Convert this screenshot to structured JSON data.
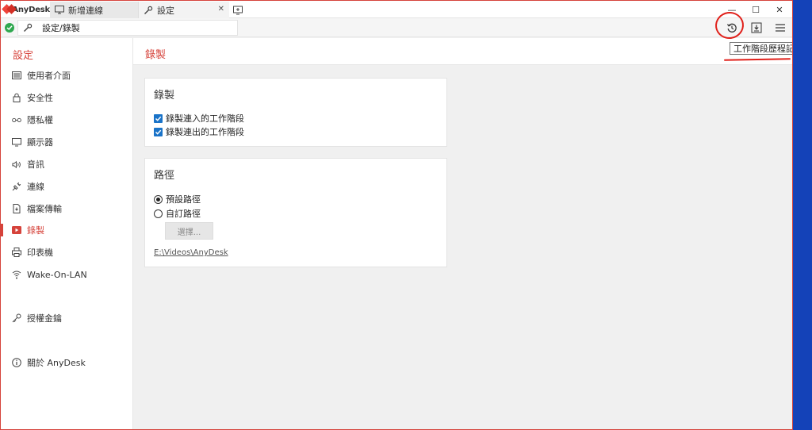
{
  "app": {
    "name": "AnyDesk"
  },
  "tabs": [
    {
      "label": "新增連線"
    },
    {
      "label": "設定"
    }
  ],
  "window_controls": {
    "minimize": "—",
    "maximize": "☐",
    "close": "✕"
  },
  "address": {
    "path": "設定/錄製"
  },
  "tooltip": {
    "text": "工作階段歷程記錄"
  },
  "sidebar": {
    "title": "設定",
    "items": [
      {
        "label": "使用者介面",
        "icon": "monitor-list-icon"
      },
      {
        "label": "安全性",
        "icon": "lock-icon"
      },
      {
        "label": "隱私權",
        "icon": "glasses-icon"
      },
      {
        "label": "顯示器",
        "icon": "display-icon"
      },
      {
        "label": "音訊",
        "icon": "speaker-icon"
      },
      {
        "label": "連線",
        "icon": "plug-icon"
      },
      {
        "label": "檔案傳輸",
        "icon": "file-icon"
      },
      {
        "label": "錄製",
        "icon": "record-icon",
        "active": true
      },
      {
        "label": "印表機",
        "icon": "printer-icon"
      },
      {
        "label": "Wake-On-LAN",
        "icon": "wifi-icon"
      },
      {
        "label": "授權金鑰",
        "icon": "key-icon"
      },
      {
        "label": "關於 AnyDesk",
        "icon": "info-icon"
      }
    ]
  },
  "main": {
    "title": "錄製",
    "recording": {
      "title": "錄製",
      "options": [
        {
          "label": "錄製連入的工作階段",
          "checked": true
        },
        {
          "label": "錄製連出的工作階段",
          "checked": true
        }
      ]
    },
    "path": {
      "title": "路徑",
      "options": [
        {
          "label": "預設路徑",
          "selected": true
        },
        {
          "label": "自訂路徑",
          "selected": false
        }
      ],
      "choose_label": "選擇...",
      "current_path": "E:\\Videos\\AnyDesk"
    }
  },
  "colors": {
    "accent": "#d6433b",
    "checkbox": "#1a73c8",
    "status_ok": "#2fa84f",
    "annotation": "#e0201a"
  }
}
